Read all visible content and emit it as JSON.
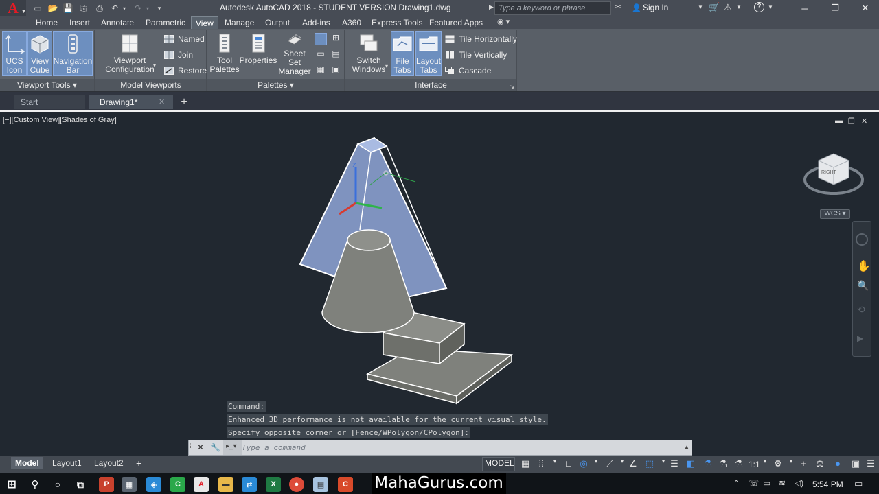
{
  "title_bar": {
    "title": "Autodesk AutoCAD 2018 - STUDENT VERSION    Drawing1.dwg",
    "search_placeholder": "Type a keyword or phrase",
    "sign_in": "Sign In",
    "app_letter": "A"
  },
  "ribbon": {
    "tabs": [
      "Home",
      "Insert",
      "Annotate",
      "Parametric",
      "View",
      "Manage",
      "Output",
      "Add-ins",
      "A360",
      "Express Tools",
      "Featured Apps"
    ],
    "active_tab": "View",
    "panels": {
      "viewport_tools": {
        "title": "Viewport Tools",
        "buttons": [
          "UCS\nIcon",
          "View\nCube",
          "Navigation\nBar"
        ]
      },
      "model_viewports": {
        "title": "Model Viewports",
        "config": "Viewport\nConfiguration",
        "named": "Named",
        "join": "Join",
        "restore": "Restore"
      },
      "palettes": {
        "title": "Palettes",
        "tool_palettes": "Tool\nPalettes",
        "properties": "Properties",
        "sheet_set": "Sheet Set\nManager"
      },
      "interface": {
        "title": "Interface",
        "switch_windows": "Switch\nWindows",
        "file_tabs": "File\nTabs",
        "layout_tabs": "Layout\nTabs",
        "tile_h": "Tile Horizontally",
        "tile_v": "Tile Vertically",
        "cascade": "Cascade"
      }
    }
  },
  "file_tabs": {
    "start": "Start",
    "drawing": "Drawing1*"
  },
  "viewport": {
    "label": "[−][Custom View][Shades of Gray]",
    "viewcube_face": "RIGHT",
    "wcs": "WCS",
    "axis_z": "Z"
  },
  "command": {
    "history": [
      "Command:",
      "Enhanced 3D performance is not available for the current visual style.",
      "Specify opposite corner or [Fence/WPolygon/CPolygon]:"
    ],
    "placeholder": "Type a command"
  },
  "layout_tabs": [
    "Model",
    "Layout1",
    "Layout2"
  ],
  "status_bar": {
    "mode": "MODEL",
    "scale": "1:1"
  },
  "taskbar": {
    "brand": "MahaGurus.com",
    "time": "5:54 PM"
  },
  "colors": {
    "accent_red": "#e21b25",
    "selection_blue": "#8fa6d8",
    "solid_gray": "#7f817c",
    "viewport_bg": "#212830"
  }
}
